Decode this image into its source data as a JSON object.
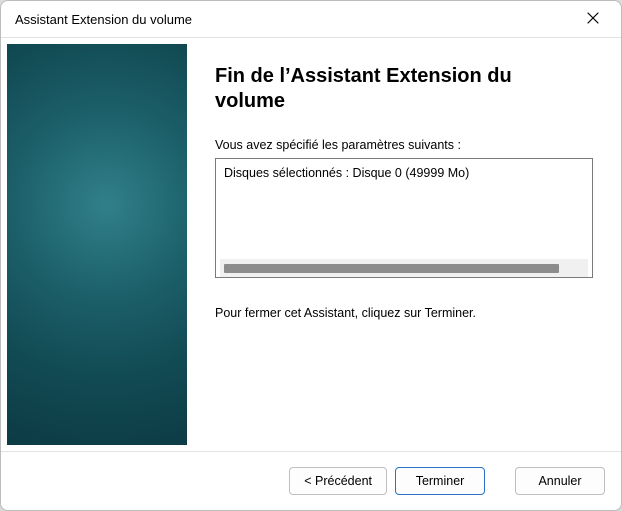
{
  "window": {
    "title": "Assistant Extension du volume"
  },
  "main": {
    "heading": "Fin de l’Assistant Extension du volume",
    "intro": "Vous avez spécifié les paramètres suivants :",
    "summary_lines": [
      "Disques sélectionnés : Disque 0 (49999 Mo)"
    ],
    "close_text": "Pour fermer cet Assistant, cliquez sur Terminer."
  },
  "buttons": {
    "back": "< Précédent",
    "finish": "Terminer",
    "cancel": "Annuler"
  }
}
